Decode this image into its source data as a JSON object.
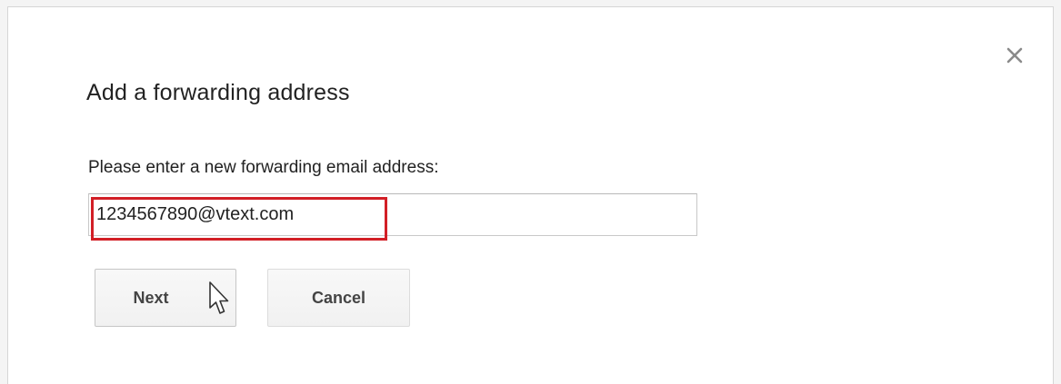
{
  "dialog": {
    "title": "Add a forwarding address",
    "prompt": "Please enter a new forwarding email address:",
    "email_input": {
      "value": "1234567890@vtext.com",
      "placeholder": ""
    },
    "buttons": {
      "next_label": "Next",
      "cancel_label": "Cancel"
    },
    "close_icon": "close-icon"
  },
  "colors": {
    "highlight_border": "#d21f26",
    "text": "#222222",
    "button_text": "#444444"
  }
}
